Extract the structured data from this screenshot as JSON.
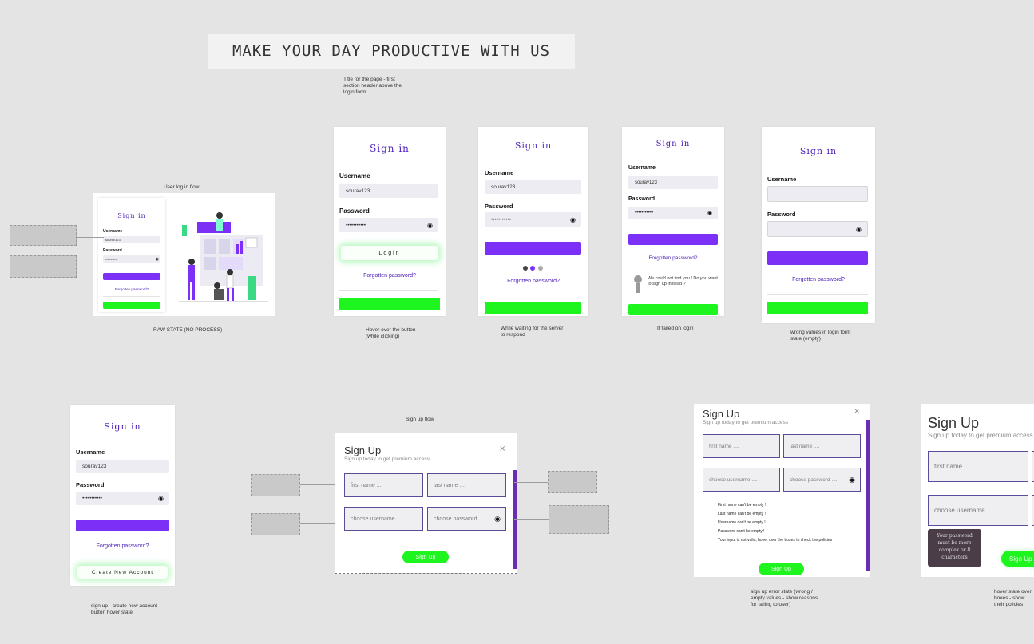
{
  "banner": {
    "title": "MAKE YOUR DAY PRODUCTIVE WITH US",
    "note": "Title for the page - first section header above the login form"
  },
  "flows": {
    "login": "User log in flow",
    "signup": "Sign up flow"
  },
  "signin": {
    "title": "Sign in",
    "username_label": "Username",
    "password_label": "Password",
    "username_value": "sourav123",
    "password_value": "•••••••••••",
    "login_label": "Login",
    "forgot": "Forgotten password?",
    "create": "Create New Account",
    "error_msg": "We could not find you ! Do you want to sign up instead ?"
  },
  "signup": {
    "title": "Sign Up",
    "subtitle": "Sign up today to get premium access",
    "first": "first name ....",
    "last": "last name ....",
    "user": "choose username ....",
    "pass": "choose password ....",
    "button": "Sign Up",
    "tooltip": "Your password must be more complex or 8 characters"
  },
  "errors": [
    "First name can't be empty !",
    "Last name can't be empty !",
    "Username can't be empty !",
    "Password can't be empty !",
    "Your input is not valid, hover over the boxes to check the policies !"
  ],
  "captions": {
    "raw": "RAW STATE (NO PROCESS)",
    "hover": "Hover over the button (while clicking)",
    "waiting": "While waiting for the server to respond",
    "failed": "If failed on login",
    "wrong": "wrong values in login form state (empty)",
    "create_hover": "sign up - create new account button hover state",
    "su_error": "sign up error state (wrong / empty values - show reasons for failing to user)",
    "su_hover": "hover state over boxes - show their policies"
  },
  "icons": {
    "eye": "eye-icon",
    "close": "close-icon",
    "person": "person-icon"
  },
  "colors": {
    "purple": "#7b2ff7",
    "green": "#1ef51e",
    "title": "#4a1fb8"
  }
}
